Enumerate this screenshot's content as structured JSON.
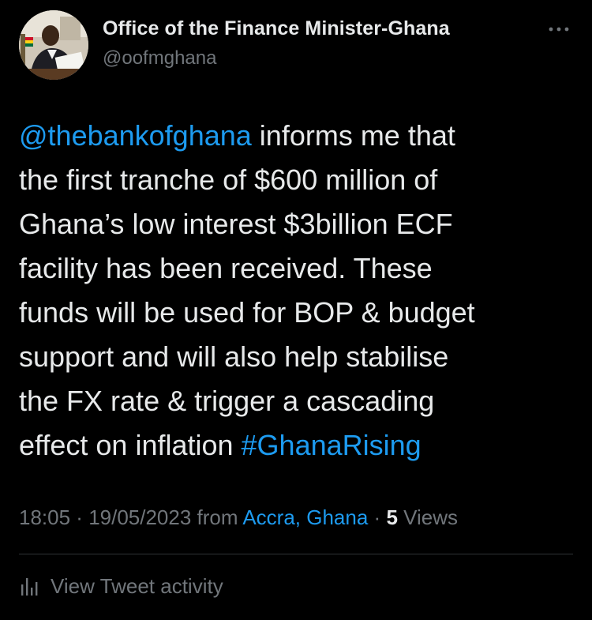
{
  "author": {
    "display_name": "Office of the Finance Minister-Ghana",
    "handle": "@oofmghana",
    "avatar_icon": "profile-photo"
  },
  "more_icon": "more-horizontal-icon",
  "tweet": {
    "mention": "@thebankofghana",
    "lines": [
      " informs me that",
      "the first tranche of $600 million of",
      "Ghana’s low interest $3billion ECF",
      "facility has been received. These",
      "funds will be used for BOP & budget",
      "support and will also help stabilise",
      "the FX rate & trigger a cascading",
      "effect on inflation "
    ],
    "hashtag": "#GhanaRising"
  },
  "meta": {
    "time": "18:05",
    "separator": " · ",
    "date": "19/05/2023",
    "from_label": " from ",
    "location": "Accra, Ghana",
    "separator2": " · ",
    "views_count": "5",
    "views_label": " Views"
  },
  "activity": {
    "label": "View Tweet activity",
    "icon": "bar-chart-icon"
  },
  "colors": {
    "background": "#000000",
    "primary_text": "#e7e9ea",
    "secondary_text": "#71767b",
    "link": "#1d9bf0",
    "divider": "#2f3336"
  }
}
